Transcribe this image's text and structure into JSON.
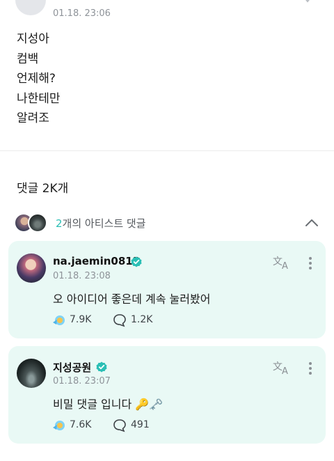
{
  "post": {
    "time": "01.18. 23:06",
    "lines": [
      "지성아",
      "컴백",
      "언제해?",
      "나한테만",
      "알려조"
    ]
  },
  "comments_header": {
    "title": "댓글 2K개"
  },
  "artist_comments": {
    "count": "2",
    "label_suffix": "개의 아티스트 댓글"
  },
  "comments": [
    {
      "author": "na.jaemin0813",
      "time": "01.18. 23:08",
      "text": "오 아이디어 좋은데 계속 눌러봤어",
      "likes": "7.9K",
      "replies": "1.2K"
    },
    {
      "author": "지성공원",
      "time": "01.18. 23:07",
      "text": "비밀 댓글 입니다 🔑🗝️",
      "likes": "7.6K",
      "replies": "491"
    }
  ],
  "colors": {
    "card_bg": "#e9f9f5",
    "accent": "#2bbfb5",
    "muted_text": "#8e9399"
  },
  "icons": [
    "translate-icon",
    "more-vertical-icon",
    "verified-badge-icon",
    "reaction-icon",
    "comment-bubble-icon",
    "chevron-up-icon"
  ]
}
